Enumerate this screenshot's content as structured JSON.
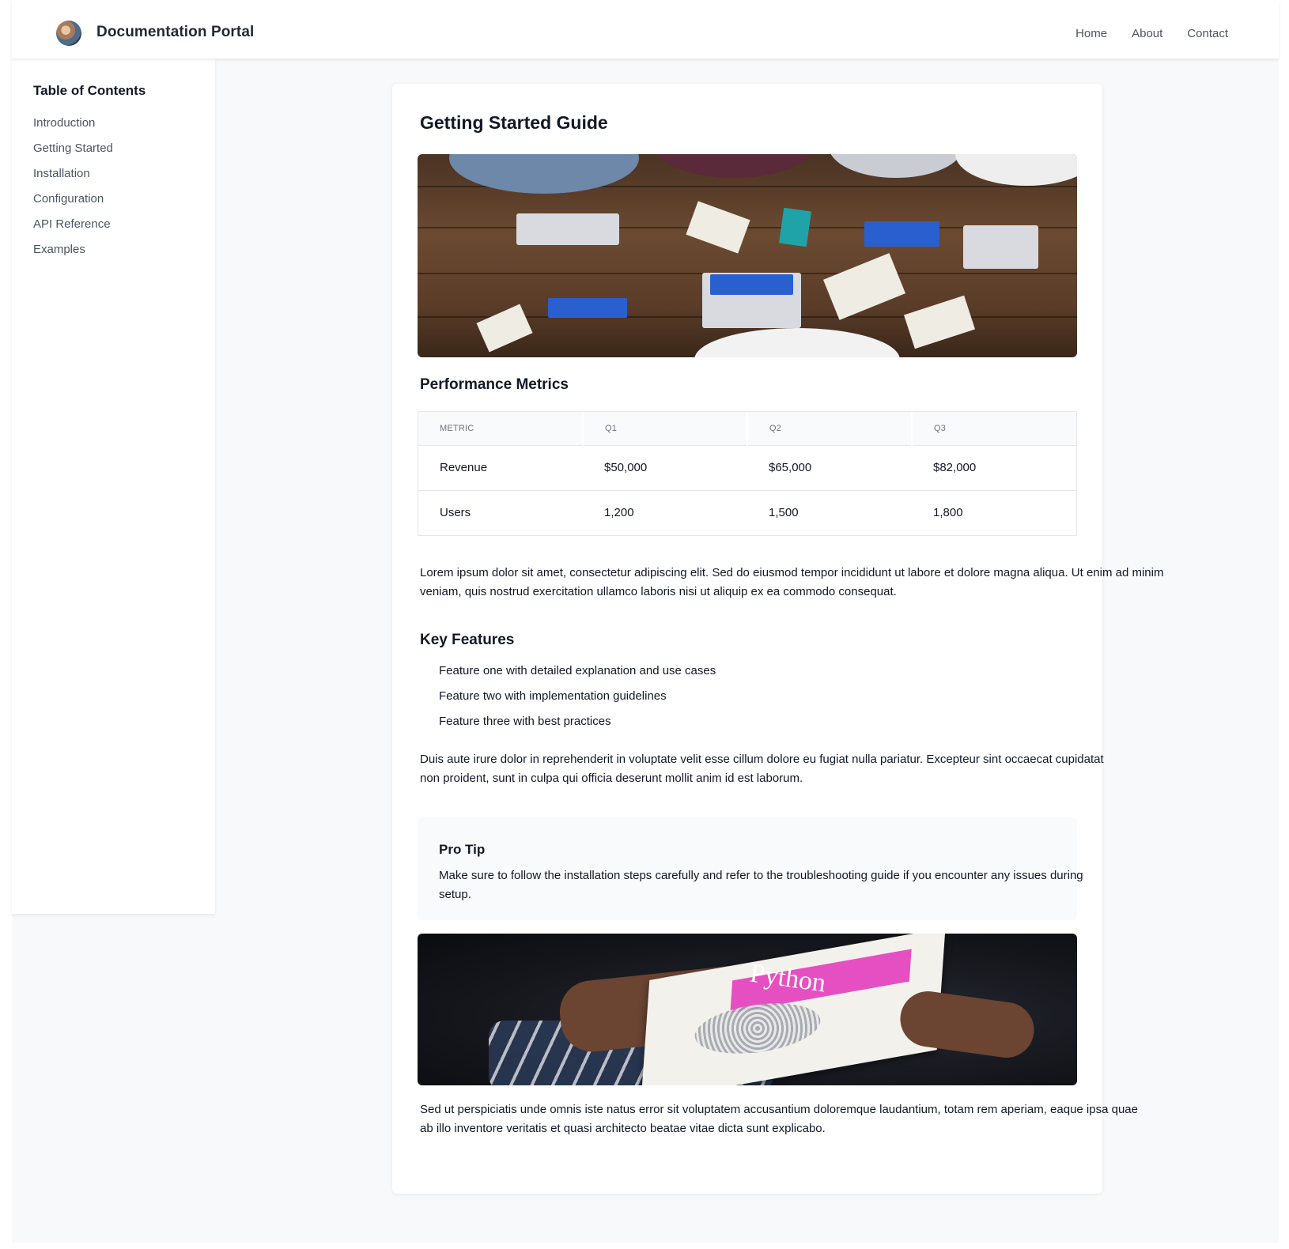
{
  "header": {
    "brand": "Documentation Portal",
    "nav": [
      "Home",
      "About",
      "Contact"
    ]
  },
  "sidebar": {
    "title": "Table of Contents",
    "items": [
      "Introduction",
      "Getting Started",
      "Installation",
      "Configuration",
      "API Reference",
      "Examples"
    ]
  },
  "main": {
    "title": "Getting Started Guide",
    "metrics": {
      "title": "Performance Metrics",
      "columns": [
        "METRIC",
        "Q1",
        "Q2",
        "Q3"
      ],
      "rows": [
        [
          "Revenue",
          "$50,000",
          "$65,000",
          "$82,000"
        ],
        [
          "Users",
          "1,200",
          "1,500",
          "1,800"
        ]
      ]
    },
    "paragraph1": "Lorem ipsum dolor sit amet, consectetur adipiscing elit. Sed do eiusmod tempor incididunt ut labore et dolore magna aliqua. Ut enim ad minim veniam, quis nostrud exercitation ullamco laboris nisi ut aliquip ex ea commodo consequat.",
    "features": {
      "title": "Key Features",
      "items": [
        "Feature one with detailed explanation and use cases",
        "Feature two with implementation guidelines",
        "Feature three with best practices"
      ]
    },
    "paragraph2": "Duis aute irure dolor in reprehenderit in voluptate velit esse cillum dolore eu fugiat nulla pariatur. Excepteur sint occaecat cupidatat non proident, sunt in culpa qui officia deserunt mollit anim id est laborum.",
    "tip": {
      "title": "Pro Tip",
      "text": "Make sure to follow the installation steps carefully and refer to the troubleshooting guide if you encounter any issues during setup."
    },
    "book_cover_text": "Python",
    "paragraph3": "Sed ut perspiciatis unde omnis iste natus error sit voluptatem accusantium doloremque laudantium, totam rem aperiam, eaque ipsa quae ab illo inventore veritatis et quasi architecto beatae vitae dicta sunt explicabo."
  }
}
